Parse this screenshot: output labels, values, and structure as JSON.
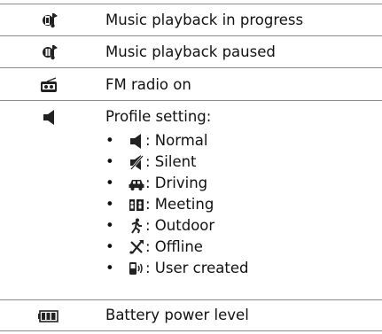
{
  "rows": [
    {
      "icon": "music-playing-icon",
      "label": "Music playback in progress"
    },
    {
      "icon": "music-paused-icon",
      "label": "Music playback paused"
    },
    {
      "icon": "fm-radio-icon",
      "label": "FM radio on"
    },
    {
      "icon": "speaker-icon",
      "label": "Profile setting:"
    },
    {
      "icon": "battery-icon",
      "label": "Battery power level"
    }
  ],
  "profiles": [
    {
      "bullet": "•",
      "icon": "normal-speaker-icon",
      "label": ": Normal"
    },
    {
      "bullet": "•",
      "icon": "silent-icon",
      "label": ": Silent"
    },
    {
      "bullet": "•",
      "icon": "car-icon",
      "label": ": Driving"
    },
    {
      "bullet": "•",
      "icon": "meeting-icon",
      "label": ": Meeting"
    },
    {
      "bullet": "•",
      "icon": "running-person-icon",
      "label": ": Outdoor"
    },
    {
      "bullet": "•",
      "icon": "airplane-off-icon",
      "label": ": Offline"
    },
    {
      "bullet": "•",
      "icon": "user-phone-icon",
      "label": ": User created"
    }
  ]
}
